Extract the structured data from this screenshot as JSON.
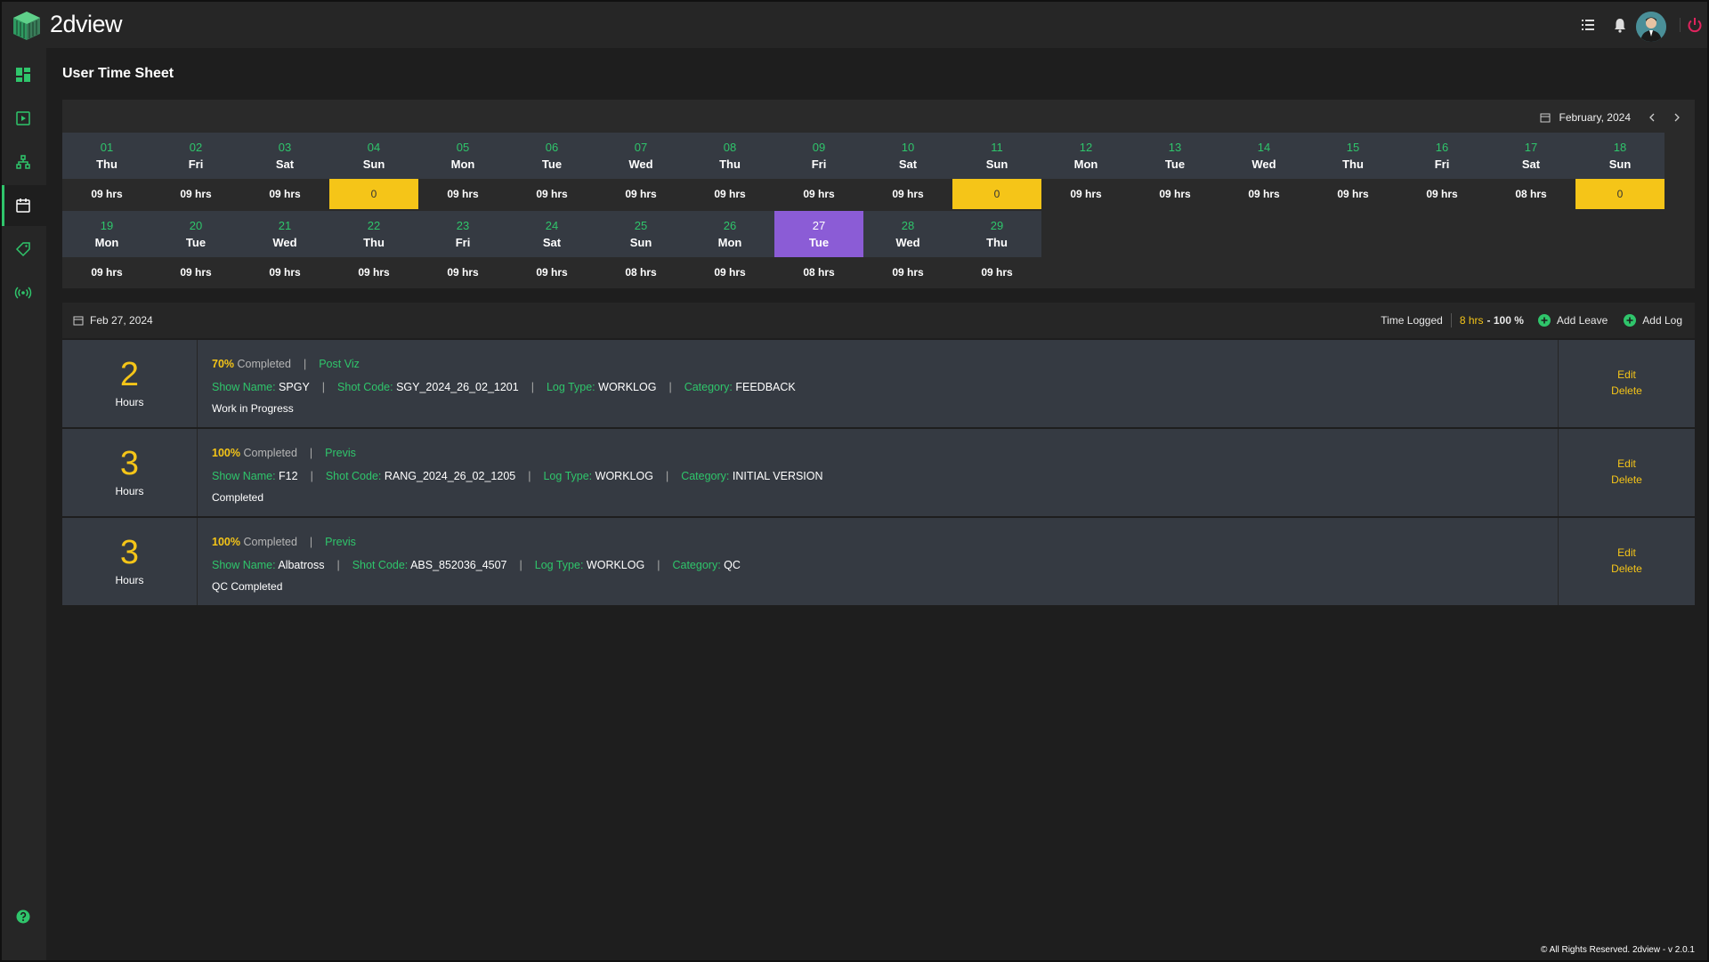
{
  "app": {
    "brand": "2dview"
  },
  "page": {
    "title": "User Time Sheet"
  },
  "calendar": {
    "month_label": "February, 2024",
    "row1": [
      {
        "num": "01",
        "day": "Thu",
        "hrs": "09 hrs",
        "zero": false
      },
      {
        "num": "02",
        "day": "Fri",
        "hrs": "09 hrs",
        "zero": false
      },
      {
        "num": "03",
        "day": "Sat",
        "hrs": "09 hrs",
        "zero": false
      },
      {
        "num": "04",
        "day": "Sun",
        "hrs": "0",
        "zero": true
      },
      {
        "num": "05",
        "day": "Mon",
        "hrs": "09 hrs",
        "zero": false
      },
      {
        "num": "06",
        "day": "Tue",
        "hrs": "09 hrs",
        "zero": false
      },
      {
        "num": "07",
        "day": "Wed",
        "hrs": "09 hrs",
        "zero": false
      },
      {
        "num": "08",
        "day": "Thu",
        "hrs": "09 hrs",
        "zero": false
      },
      {
        "num": "09",
        "day": "Fri",
        "hrs": "09 hrs",
        "zero": false
      },
      {
        "num": "10",
        "day": "Sat",
        "hrs": "09 hrs",
        "zero": false
      },
      {
        "num": "11",
        "day": "Sun",
        "hrs": "0",
        "zero": true
      },
      {
        "num": "12",
        "day": "Mon",
        "hrs": "09 hrs",
        "zero": false
      },
      {
        "num": "13",
        "day": "Tue",
        "hrs": "09 hrs",
        "zero": false
      },
      {
        "num": "14",
        "day": "Wed",
        "hrs": "09 hrs",
        "zero": false
      },
      {
        "num": "15",
        "day": "Thu",
        "hrs": "09 hrs",
        "zero": false
      },
      {
        "num": "16",
        "day": "Fri",
        "hrs": "09 hrs",
        "zero": false
      },
      {
        "num": "17",
        "day": "Sat",
        "hrs": "08 hrs",
        "zero": false
      },
      {
        "num": "18",
        "day": "Sun",
        "hrs": "0",
        "zero": true
      }
    ],
    "row2": [
      {
        "num": "19",
        "day": "Mon",
        "hrs": "09 hrs",
        "today": false
      },
      {
        "num": "20",
        "day": "Tue",
        "hrs": "09 hrs",
        "today": false
      },
      {
        "num": "21",
        "day": "Wed",
        "hrs": "09 hrs",
        "today": false
      },
      {
        "num": "22",
        "day": "Thu",
        "hrs": "09 hrs",
        "today": false
      },
      {
        "num": "23",
        "day": "Fri",
        "hrs": "09 hrs",
        "today": false
      },
      {
        "num": "24",
        "day": "Sat",
        "hrs": "09 hrs",
        "today": false
      },
      {
        "num": "25",
        "day": "Sun",
        "hrs": "08 hrs",
        "today": false
      },
      {
        "num": "26",
        "day": "Mon",
        "hrs": "09 hrs",
        "today": false
      },
      {
        "num": "27",
        "day": "Tue",
        "hrs": "08 hrs",
        "today": true
      },
      {
        "num": "28",
        "day": "Wed",
        "hrs": "09 hrs",
        "today": false
      },
      {
        "num": "29",
        "day": "Thu",
        "hrs": "09 hrs",
        "today": false
      }
    ]
  },
  "log": {
    "date": "Feb 27, 2024",
    "time_logged_label": "Time Logged",
    "time_logged_hrs": "8 hrs",
    "time_logged_pct": "- 100 %",
    "add_leave": "Add Leave",
    "add_log": "Add Log"
  },
  "entries": [
    {
      "hours": "2",
      "unit": "Hours",
      "pct": "70%",
      "completed": "Completed",
      "stage": "Post Viz",
      "show_label": "Show Name:",
      "show": "SPGY",
      "shot_label": "Shot Code:",
      "shot": "SGY_2024_26_02_1201",
      "logtype_label": "Log Type:",
      "logtype": "WORKLOG",
      "cat_label": "Category:",
      "cat": "FEEDBACK",
      "status": "Work in Progress",
      "edit": "Edit",
      "delete": "Delete"
    },
    {
      "hours": "3",
      "unit": "Hours",
      "pct": "100%",
      "completed": "Completed",
      "stage": "Previs",
      "show_label": "Show Name:",
      "show": "F12",
      "shot_label": "Shot Code:",
      "shot": "RANG_2024_26_02_1205",
      "logtype_label": "Log Type:",
      "logtype": "WORKLOG",
      "cat_label": "Category:",
      "cat": "INITIAL VERSION",
      "status": "Completed",
      "edit": "Edit",
      "delete": "Delete"
    },
    {
      "hours": "3",
      "unit": "Hours",
      "pct": "100%",
      "completed": "Completed",
      "stage": "Previs",
      "show_label": "Show Name:",
      "show": "Albatross",
      "shot_label": "Shot Code:",
      "shot": "ABS_852036_4507",
      "logtype_label": "Log Type:",
      "logtype": "WORKLOG",
      "cat_label": "Category:",
      "cat": "QC",
      "status": "QC Completed",
      "edit": "Edit",
      "delete": "Delete"
    }
  ],
  "footer": {
    "text": "© All Rights Reserved. 2dview - v 2.0.1"
  },
  "colors": {
    "accent": "#2fc56b",
    "highlight": "#f5c518",
    "today": "#8b5cd6",
    "panel": "#353a42"
  }
}
